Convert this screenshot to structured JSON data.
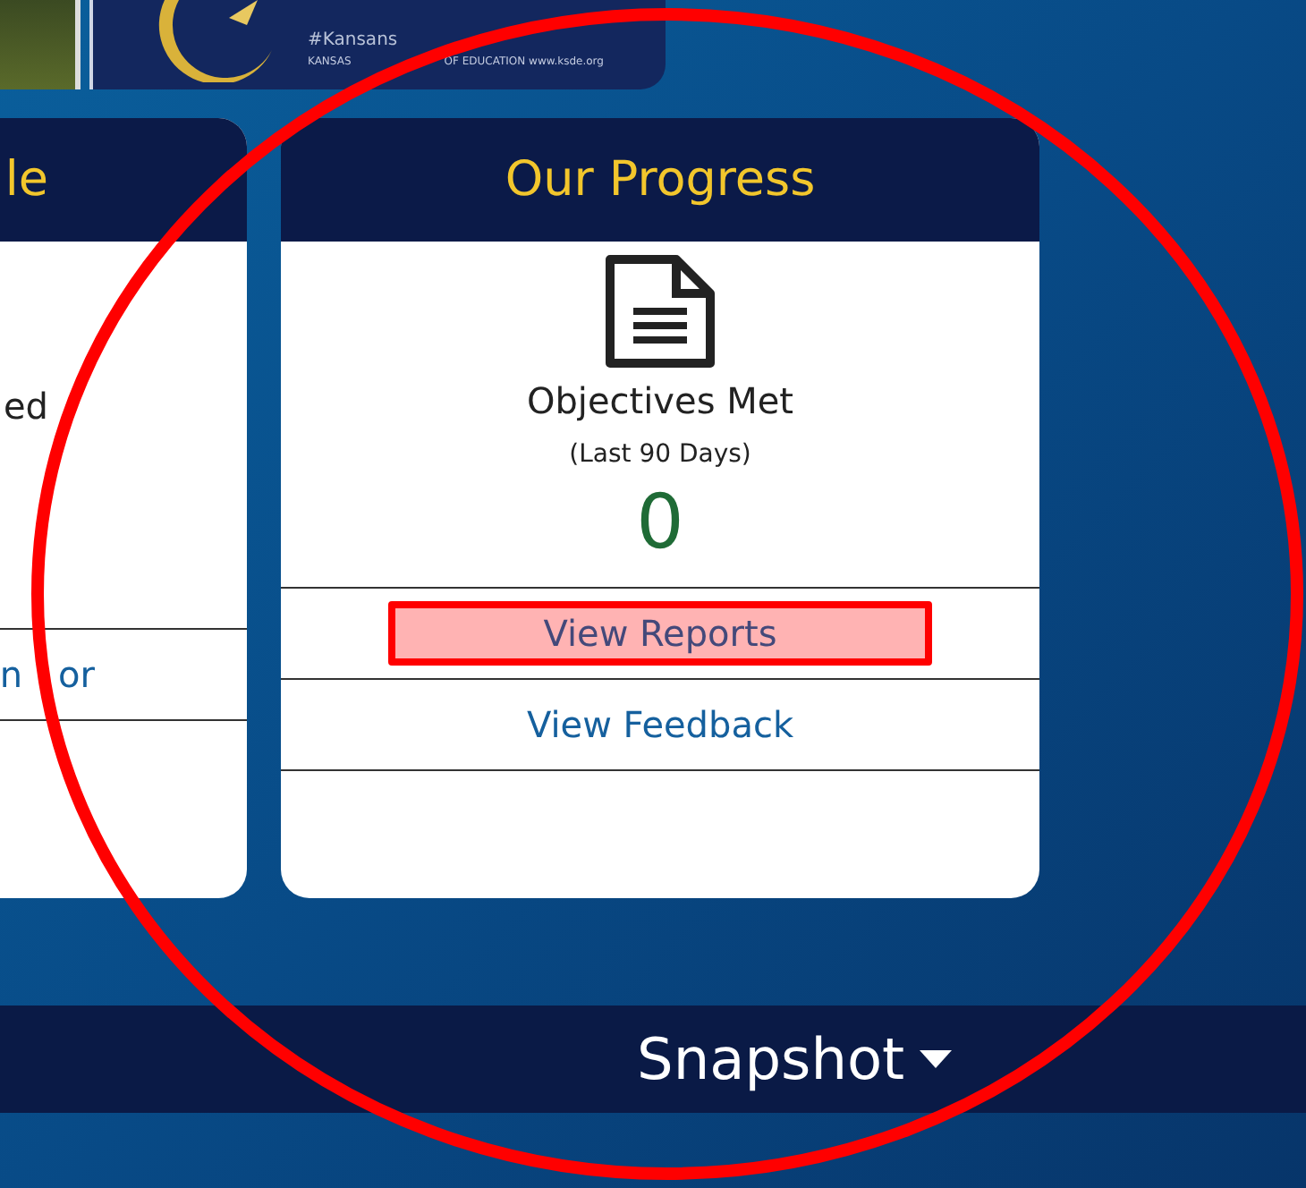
{
  "banner": {
    "hashtag": "#Kansans",
    "org_line_parts": [
      "KANSAS",
      "OF EDUCATION   www.ksde.org"
    ]
  },
  "cards": [
    {
      "title": "le",
      "metric_label": "ed",
      "links": [
        {
          "label_parts": [
            "n",
            "or"
          ],
          "highlighted": false
        }
      ]
    },
    {
      "title": "Our Progress",
      "metric_label": "Objectives Met",
      "period": "(Last 90 Days)",
      "value": "0",
      "links": [
        {
          "label": "View Reports",
          "highlighted": true
        },
        {
          "label": "View Feedback",
          "highlighted": false
        }
      ]
    }
  ],
  "footer": {
    "label": "Snapshot"
  },
  "annotations": [
    {
      "kind": "ellipse"
    }
  ]
}
